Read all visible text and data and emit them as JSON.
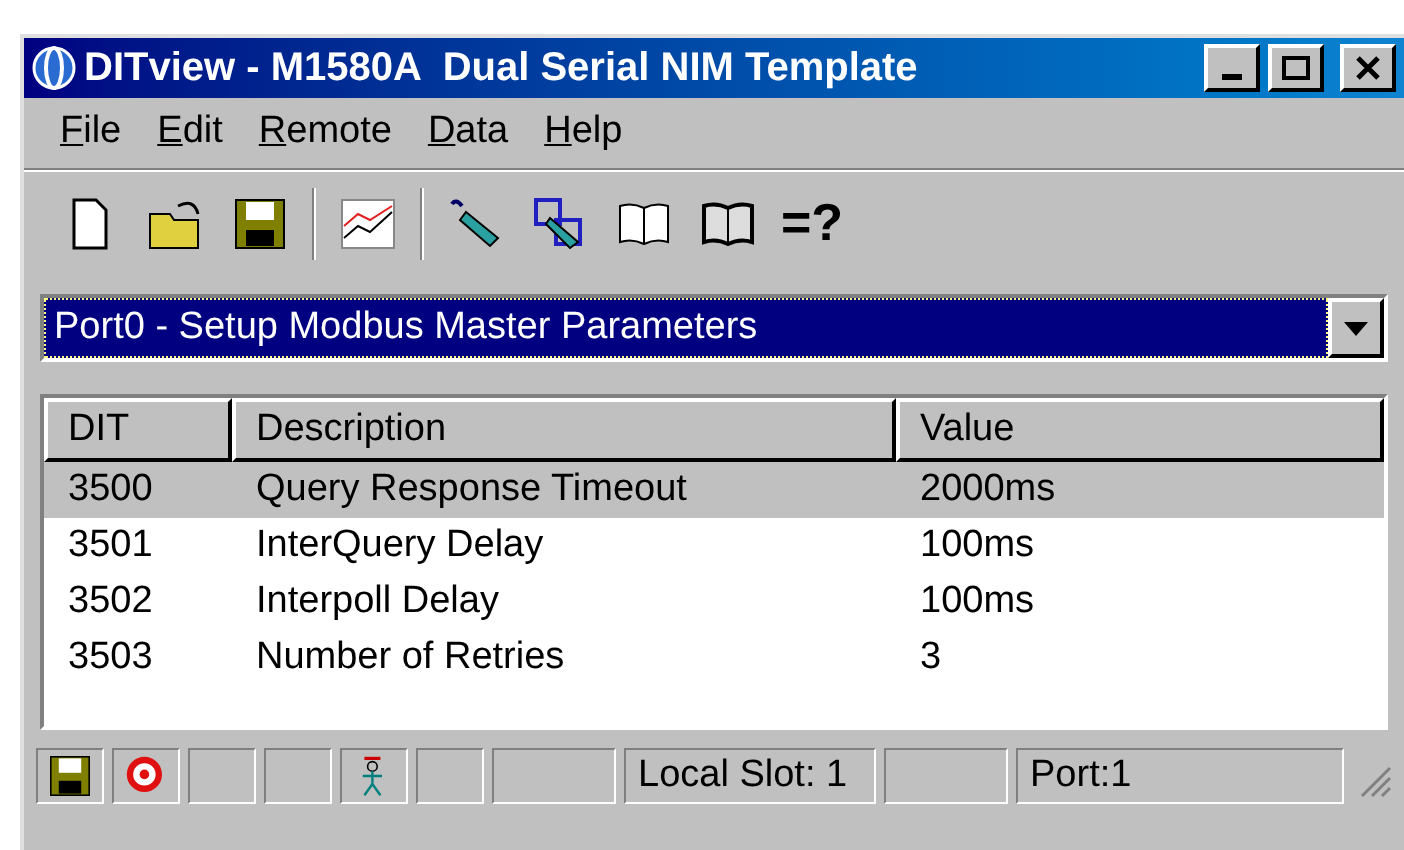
{
  "window": {
    "title": "DITview - M1580A  Dual Serial NIM Template"
  },
  "menu": [
    "File",
    "Edit",
    "Remote",
    "Data",
    "Help"
  ],
  "toolbar": [
    {
      "kind": "new"
    },
    {
      "kind": "open"
    },
    {
      "kind": "save"
    },
    {
      "kind": "sep"
    },
    {
      "kind": "chart"
    },
    {
      "kind": "sep"
    },
    {
      "kind": "probe"
    },
    {
      "kind": "network"
    },
    {
      "kind": "book"
    },
    {
      "kind": "book2"
    },
    {
      "kind": "text",
      "label": "=?"
    }
  ],
  "selector": {
    "value": "Port0 - Setup Modbus Master Parameters"
  },
  "table": {
    "columns": [
      "DIT",
      "Description",
      "Value"
    ],
    "rows": [
      {
        "cells": [
          "3500",
          "Query Response Timeout",
          "2000ms"
        ],
        "selected": true
      },
      {
        "cells": [
          "3501",
          "InterQuery Delay",
          "100ms"
        ],
        "selected": false
      },
      {
        "cells": [
          "3502",
          "Interpoll Delay",
          "100ms"
        ],
        "selected": false
      },
      {
        "cells": [
          "3503",
          "Number of Retries",
          "3"
        ],
        "selected": false
      }
    ]
  },
  "status_bar": [
    {
      "kind": "save"
    },
    {
      "kind": "target"
    },
    {
      "kind": "empty"
    },
    {
      "kind": "empty"
    },
    {
      "kind": "figure"
    },
    {
      "kind": "empty"
    },
    {
      "kind": "wide"
    },
    {
      "kind": "text",
      "text": "Local Slot: 1"
    },
    {
      "kind": "wide"
    },
    {
      "kind": "text",
      "text": "Port:1"
    }
  ]
}
